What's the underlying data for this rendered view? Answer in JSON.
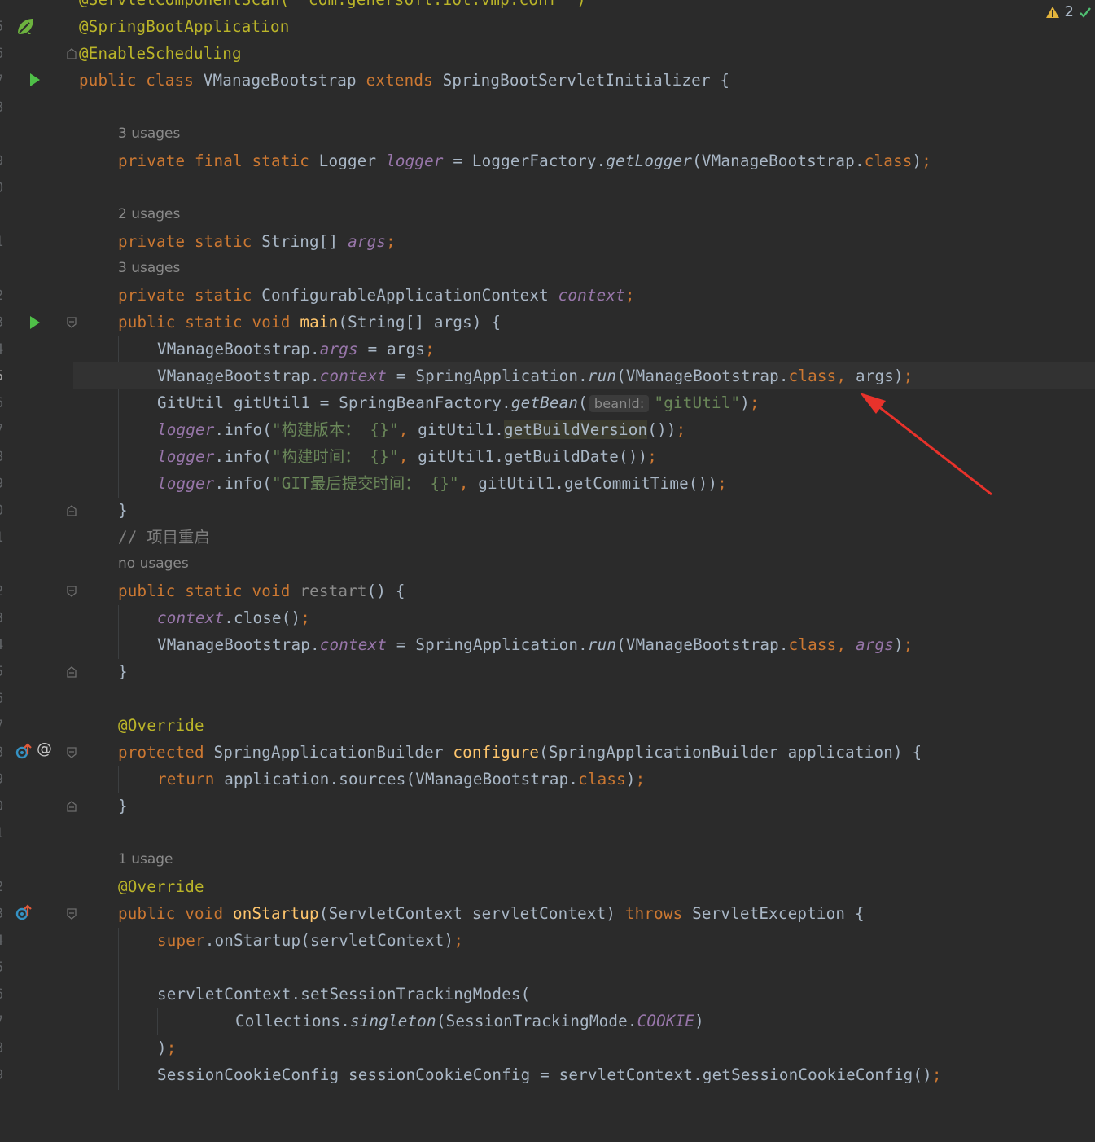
{
  "status": {
    "warning_count": "2"
  },
  "gutter": {
    "line_numbers": [
      "5",
      "6",
      "7",
      "8",
      "9",
      "0",
      "1",
      "2",
      "3",
      "4",
      "5",
      "6",
      "7",
      "8",
      "9",
      "0",
      "1",
      "2",
      "3",
      "4",
      "5",
      "6",
      "7",
      "8",
      "9",
      "0",
      "1",
      "2",
      "3",
      "4",
      "5",
      "6",
      "7",
      "8",
      "9"
    ]
  },
  "usages": {
    "logger": "3 usages",
    "args": "2 usages",
    "context": "3 usages",
    "restart": "no usages",
    "onStartup": "1 usage"
  },
  "inlay_hints": {
    "beanId": "beanId:"
  },
  "code": {
    "l0": "@ServletComponentScan( \"com.genersoft.iot.vmp.conf\" )",
    "l1": "@SpringBootApplication",
    "l2": "@EnableScheduling",
    "l3": [
      "public class",
      " VManageBootstrap ",
      "extends",
      " SpringBootServletInitializer {"
    ],
    "l5": [
      "private final static",
      " Logger ",
      "logger",
      " = LoggerFactory.",
      "getLogger",
      "(VManageBootstrap.",
      "class",
      ")",
      ";"
    ],
    "l7": [
      "private static",
      " String[] ",
      "args",
      ";"
    ],
    "l9": [
      "private static",
      " ConfigurableApplicationContext ",
      "context",
      ";"
    ],
    "l10": [
      "public static void",
      " ",
      "main",
      "(String[] args) {"
    ],
    "l11": [
      "VManageBootstrap.",
      "args",
      " = args",
      ";"
    ],
    "l12": [
      "VManageBootstrap.",
      "context",
      " = SpringApplication.",
      "run",
      "(VManageBootstrap.",
      "class",
      ",",
      " args)",
      ";"
    ],
    "l13": [
      "GitUtil gitUtil1 = SpringBeanFactory.",
      "getBean",
      "(",
      "\"gitUtil\"",
      ")",
      ";"
    ],
    "l14": [
      "logger",
      ".info(",
      "\"构建版本： {}\"",
      ",",
      " gitUtil1.",
      "getBuildVersion",
      "())",
      ";"
    ],
    "l15": [
      "logger",
      ".info(",
      "\"构建时间： {}\"",
      ",",
      " gitUtil1.getBuildDate())",
      ";"
    ],
    "l16": [
      "logger",
      ".info(",
      "\"GIT最后提交时间： {}\"",
      ",",
      " gitUtil1.getCommitTime())",
      ";"
    ],
    "l17": "}",
    "l18": "// 项目重启",
    "l19": [
      "public static void",
      " ",
      "restart",
      "() {"
    ],
    "l20": [
      "context",
      ".close()",
      ";"
    ],
    "l21": [
      "VManageBootstrap.",
      "context",
      " = SpringApplication.",
      "run",
      "(VManageBootstrap.",
      "class",
      ",",
      " ",
      "args",
      ")",
      ";"
    ],
    "l22": "}",
    "l24": "@Override",
    "l25": [
      "protected",
      " SpringApplicationBuilder ",
      "configure",
      "(SpringApplicationBuilder application) {"
    ],
    "l26": [
      "return",
      " application.sources(VManageBootstrap.",
      "class",
      ")",
      ";"
    ],
    "l27": "}",
    "l29": "@Override",
    "l30": [
      "public void",
      " ",
      "onStartup",
      "(ServletContext servletContext) ",
      "throws",
      " ServletException {"
    ],
    "l31": [
      "super",
      ".onStartup(servletContext)",
      ";"
    ],
    "l33": "servletContext.setSessionTrackingModes(",
    "l34": [
      "Collections.",
      "singleton",
      "(SessionTrackingMode.",
      "COOKIE",
      ")"
    ],
    "l35": [
      ")",
      ";"
    ],
    "l36": [
      "SessionCookieConfig sessionCookieConfig = servletContext.getSessionCookieConfig()",
      ";"
    ]
  },
  "annotation_arrow": {
    "color": "#e8322b"
  }
}
